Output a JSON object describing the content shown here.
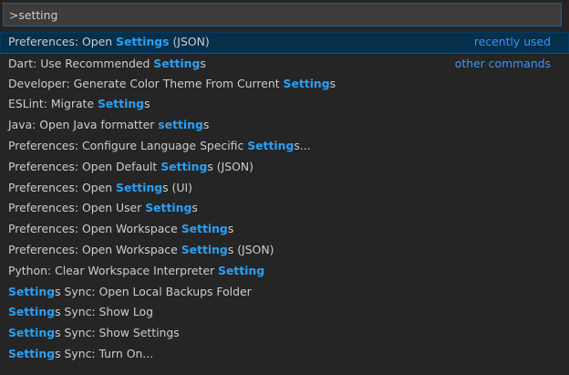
{
  "input": {
    "value": ">setting"
  },
  "colors": {
    "accent": "#2aa0f5",
    "focus_border": "#0e639c",
    "focused_row": "#062f4a"
  },
  "items": [
    {
      "pre": "Preferences: Open ",
      "hl": "Settings",
      "post": " (JSON)",
      "group": "recently used"
    },
    {
      "pre": "Dart: Use Recommended ",
      "hl": "Setting",
      "post": "s",
      "group": "other commands"
    },
    {
      "pre": "Developer: Generate Color Theme From Current ",
      "hl": "Setting",
      "post": "s",
      "group": ""
    },
    {
      "pre": "ESLint: Migrate ",
      "hl": "Setting",
      "post": "s",
      "group": ""
    },
    {
      "pre": "Java: Open Java formatter ",
      "hl": "setting",
      "post": "s",
      "group": ""
    },
    {
      "pre": "Preferences: Configure Language Specific ",
      "hl": "Setting",
      "post": "s...",
      "group": ""
    },
    {
      "pre": "Preferences: Open Default ",
      "hl": "Setting",
      "post": "s (JSON)",
      "group": ""
    },
    {
      "pre": "Preferences: Open ",
      "hl": "Setting",
      "post": "s (UI)",
      "group": ""
    },
    {
      "pre": "Preferences: Open User ",
      "hl": "Setting",
      "post": "s",
      "group": ""
    },
    {
      "pre": "Preferences: Open Workspace ",
      "hl": "Setting",
      "post": "s",
      "group": ""
    },
    {
      "pre": "Preferences: Open Workspace ",
      "hl": "Setting",
      "post": "s (JSON)",
      "group": ""
    },
    {
      "pre": "Python: Clear Workspace Interpreter ",
      "hl": "Setting",
      "post": "",
      "group": ""
    },
    {
      "pre": "",
      "hl": "Setting",
      "post": "s Sync: Open Local Backups Folder",
      "group": ""
    },
    {
      "pre": "",
      "hl": "Setting",
      "post": "s Sync: Show Log",
      "group": ""
    },
    {
      "pre": "",
      "hl": "Setting",
      "post": "s Sync: Show Settings",
      "group": ""
    },
    {
      "pre": "",
      "hl": "Setting",
      "post": "s Sync: Turn On...",
      "group": ""
    }
  ]
}
